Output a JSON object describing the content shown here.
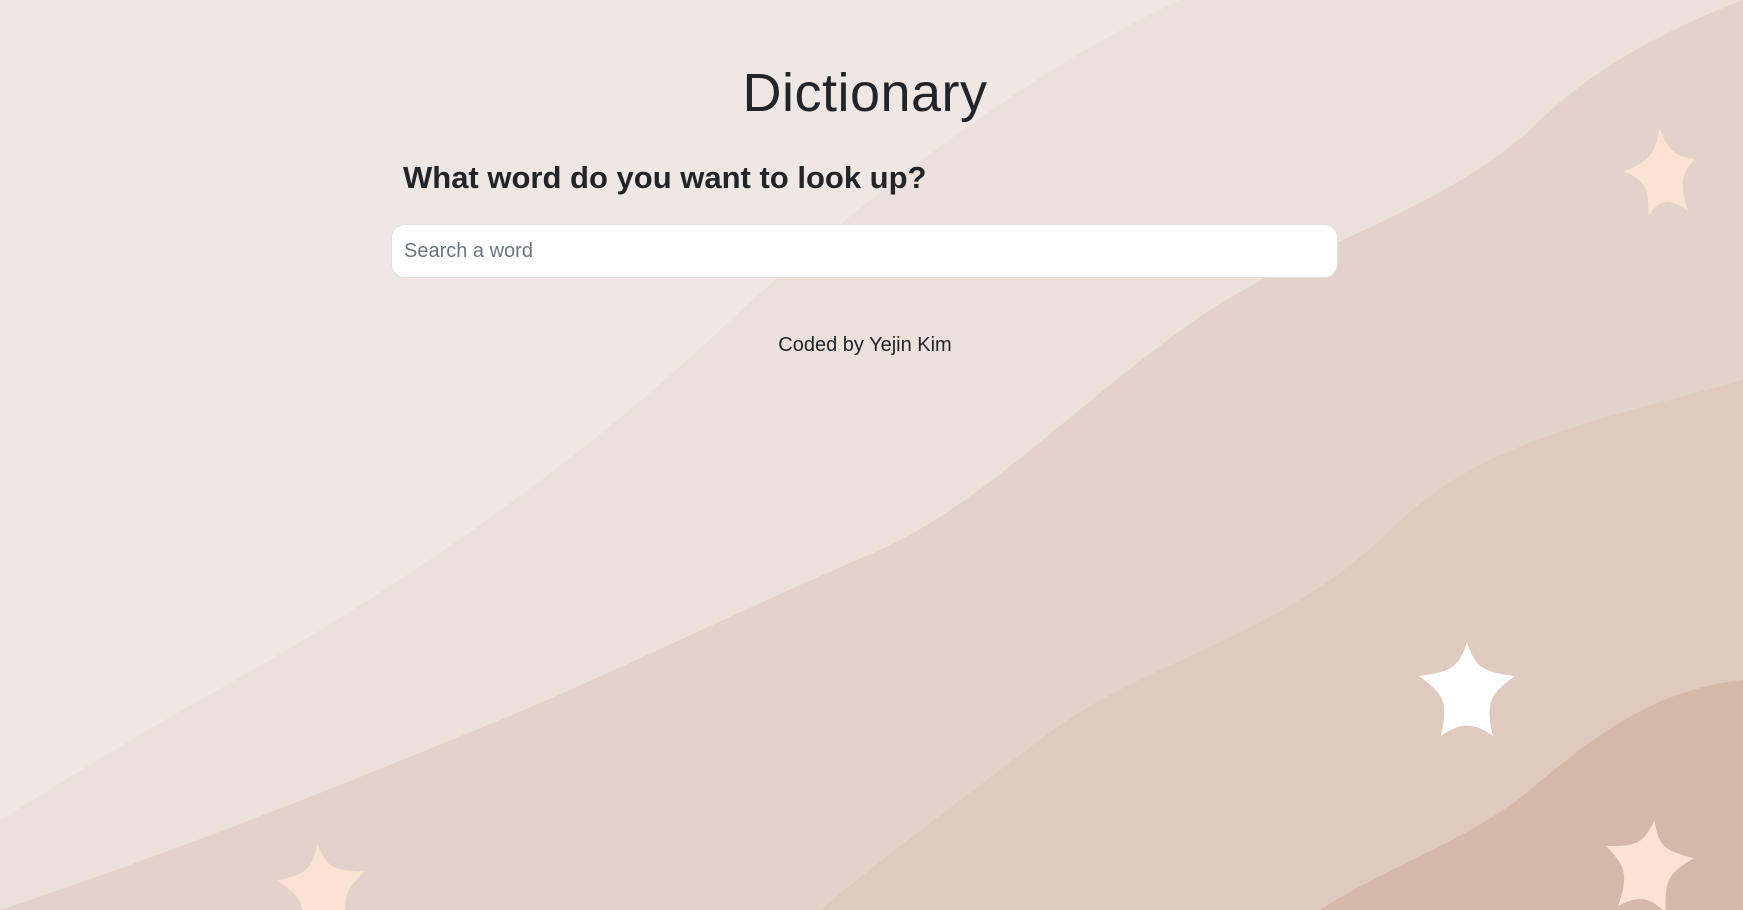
{
  "page": {
    "title": "Dictionary",
    "prompt": "What word do you want to look up?"
  },
  "search": {
    "placeholder": "Search a word",
    "value": ""
  },
  "footer": {
    "credit": "Coded by Yejin Kim"
  },
  "colors": {
    "background": "#efe7e4",
    "wave_light": "#e9ddd7",
    "wave_mid": "#e2cfc6",
    "wave_dark": "#d7b9a9",
    "star_peach": "#fbe3d4",
    "star_white": "#ffffff",
    "text": "#212529"
  },
  "icons": [
    "star-icon"
  ]
}
